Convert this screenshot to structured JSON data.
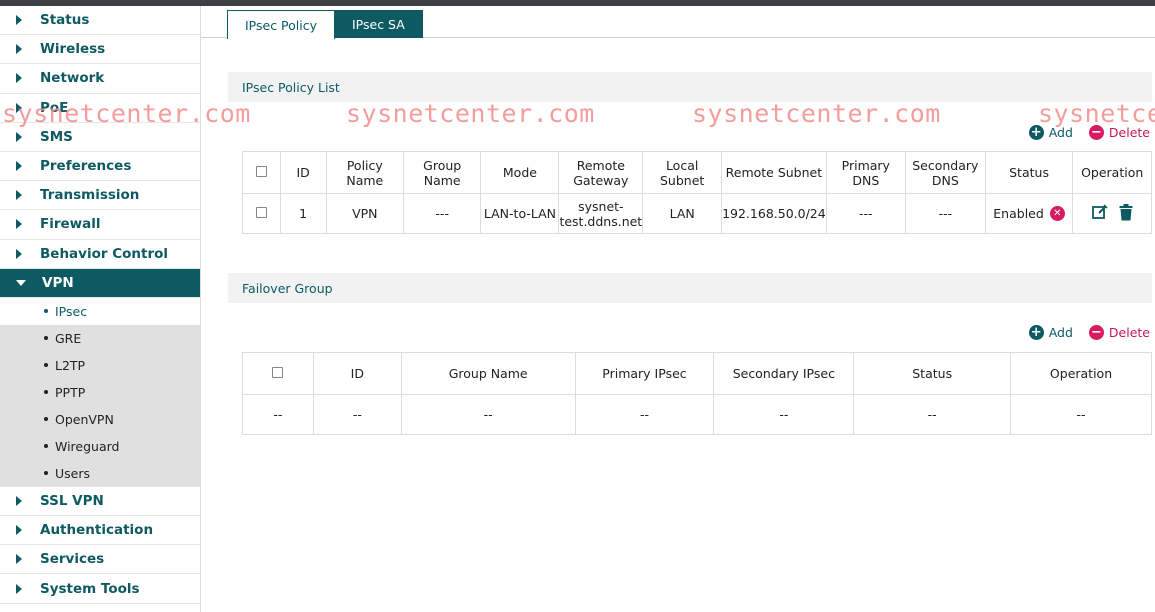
{
  "sidebar": {
    "items_top": [
      {
        "label": "Status"
      },
      {
        "label": "Wireless"
      },
      {
        "label": "Network"
      },
      {
        "label": "PoE"
      },
      {
        "label": "SMS"
      },
      {
        "label": "Preferences"
      },
      {
        "label": "Transmission"
      },
      {
        "label": "Firewall"
      },
      {
        "label": "Behavior Control"
      }
    ],
    "active": {
      "label": "VPN"
    },
    "subitems": [
      {
        "label": "IPsec"
      },
      {
        "label": "GRE"
      },
      {
        "label": "L2TP"
      },
      {
        "label": "PPTP"
      },
      {
        "label": "OpenVPN"
      },
      {
        "label": "Wireguard"
      },
      {
        "label": "Users"
      }
    ],
    "items_bottom": [
      {
        "label": "SSL VPN"
      },
      {
        "label": "Authentication"
      },
      {
        "label": "Services"
      },
      {
        "label": "System Tools"
      }
    ]
  },
  "tabs": [
    {
      "label": "IPsec Policy"
    },
    {
      "label": "IPsec SA"
    }
  ],
  "policy_section": {
    "title": "IPsec Policy List",
    "add_label": "Add",
    "delete_label": "Delete",
    "headers": [
      "ID",
      "Policy Name",
      "Group Name",
      "Mode",
      "Remote Gateway",
      "Local Subnet",
      "Remote Subnet",
      "Primary DNS",
      "Secondary DNS",
      "Status",
      "Operation"
    ],
    "rows": [
      {
        "id": "1",
        "policy_name": "VPN",
        "group_name": "---",
        "mode": "LAN-to-LAN",
        "remote_gateway": "sysnet-test.ddns.net",
        "local_subnet": "LAN",
        "remote_subnet": "192.168.50.0/24",
        "primary_dns": "---",
        "secondary_dns": "---",
        "status": "Enabled"
      }
    ]
  },
  "failover_section": {
    "title": "Failover Group",
    "add_label": "Add",
    "delete_label": "Delete",
    "headers": [
      "ID",
      "Group Name",
      "Primary IPsec",
      "Secondary IPsec",
      "Status",
      "Operation"
    ],
    "rows": [
      {
        "c0": "--",
        "c1": "--",
        "c2": "--",
        "c3": "--",
        "c4": "--",
        "c5": "--",
        "c6": "--"
      }
    ]
  },
  "watermark": "sysnetcenter.com",
  "colors": {
    "accent": "#0d5a63",
    "danger": "#d81b60"
  }
}
